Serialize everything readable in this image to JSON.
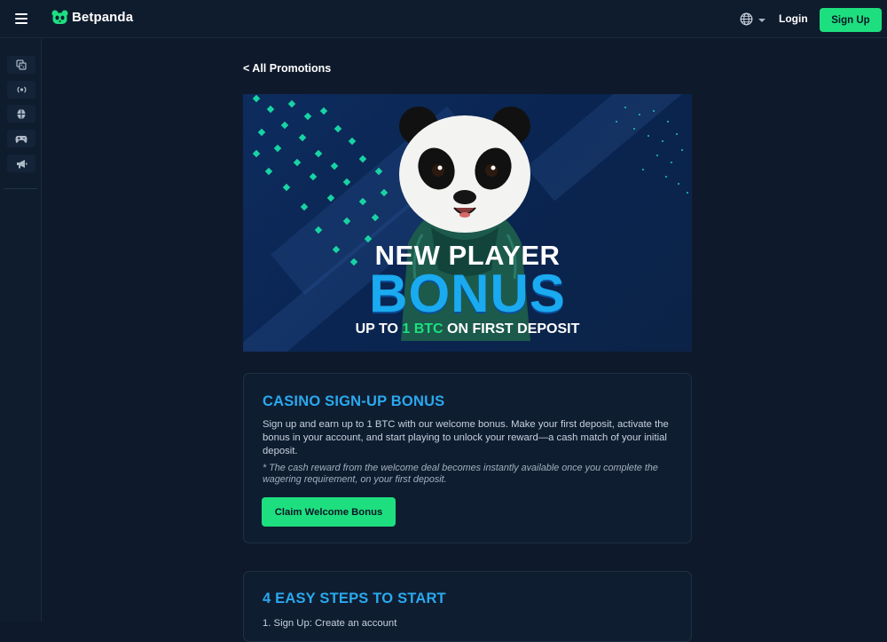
{
  "header": {
    "brand": "Betpanda",
    "login_label": "Login",
    "signup_label": "Sign Up",
    "language_icon": "globe-icon"
  },
  "sidebar": {
    "items": [
      {
        "icon": "casino-icon"
      },
      {
        "icon": "live-icon"
      },
      {
        "icon": "sports-icon"
      },
      {
        "icon": "games-icon"
      },
      {
        "icon": "promotions-icon"
      }
    ]
  },
  "main": {
    "back_label": "< All Promotions",
    "banner": {
      "line1": "NEW PLAYER",
      "line2": "BONUS",
      "line3_pre": "UP TO ",
      "line3_highlight": "1 BTC",
      "line3_post": " ON FIRST DEPOSIT"
    },
    "bonus_card": {
      "title": "CASINO SIGN-UP BONUS",
      "body": "Sign up and earn up to 1 BTC with our welcome bonus. Make your first deposit, activate the bonus in your account, and start playing to unlock your reward—a cash match of your initial deposit.",
      "note": "* The cash reward from the welcome deal becomes instantly available once you complete the wagering requirement, on your first deposit.",
      "button_label": "Claim Welcome Bonus"
    },
    "steps_card": {
      "title": "4 EASY STEPS TO START",
      "first_step": "1. Sign Up: Create an account"
    }
  },
  "colors": {
    "accent_green": "#1ddf7f",
    "accent_blue": "#2aa9ee",
    "background": "#0e1a2b"
  }
}
